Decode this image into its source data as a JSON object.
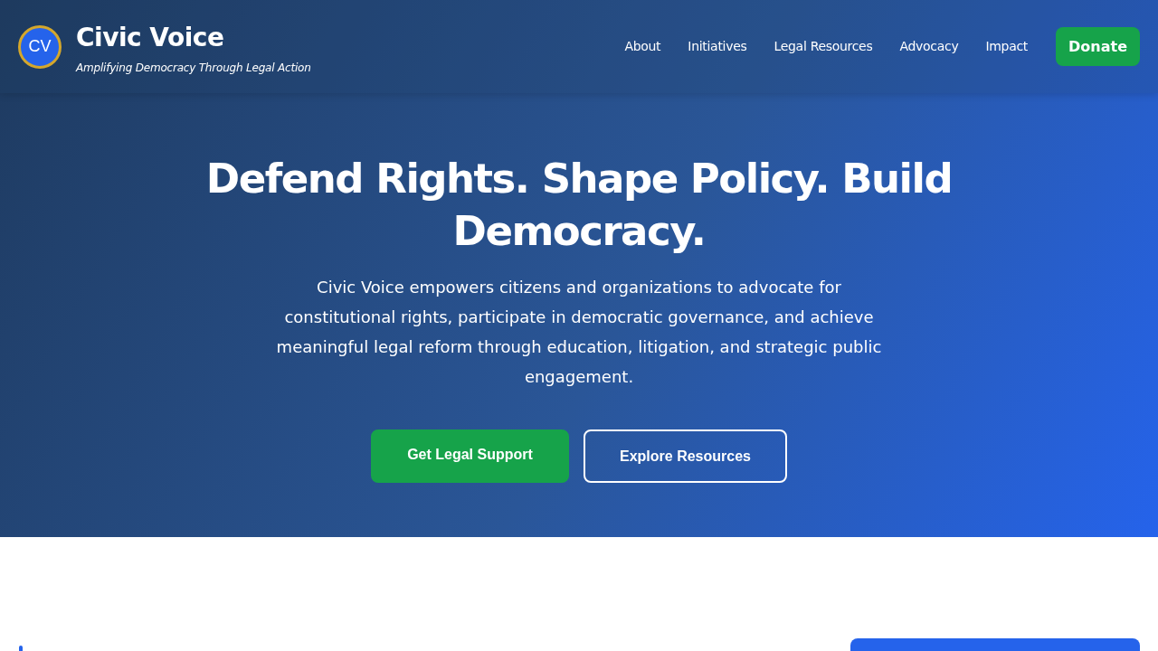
{
  "header": {
    "logo": {
      "initials": "CV"
    },
    "title": "Civic Voice",
    "tagline": "Amplifying Democracy Through Legal Action",
    "nav": [
      "About",
      "Initiatives",
      "Legal Resources",
      "Advocacy",
      "Impact"
    ],
    "donate_button": "Donate"
  },
  "hero": {
    "headline": "Defend Rights. Shape Policy. Build Democracy.",
    "description": "Civic Voice empowers citizens and organizations to advocate for constitutional rights, participate in democratic governance, and achieve meaningful legal reform through education, litigation, and strategic public engagement.",
    "buttons": [
      {
        "label": "Get Legal Support",
        "kind": "primary"
      },
      {
        "label": "Explore Resources",
        "kind": "outline"
      }
    ]
  }
}
